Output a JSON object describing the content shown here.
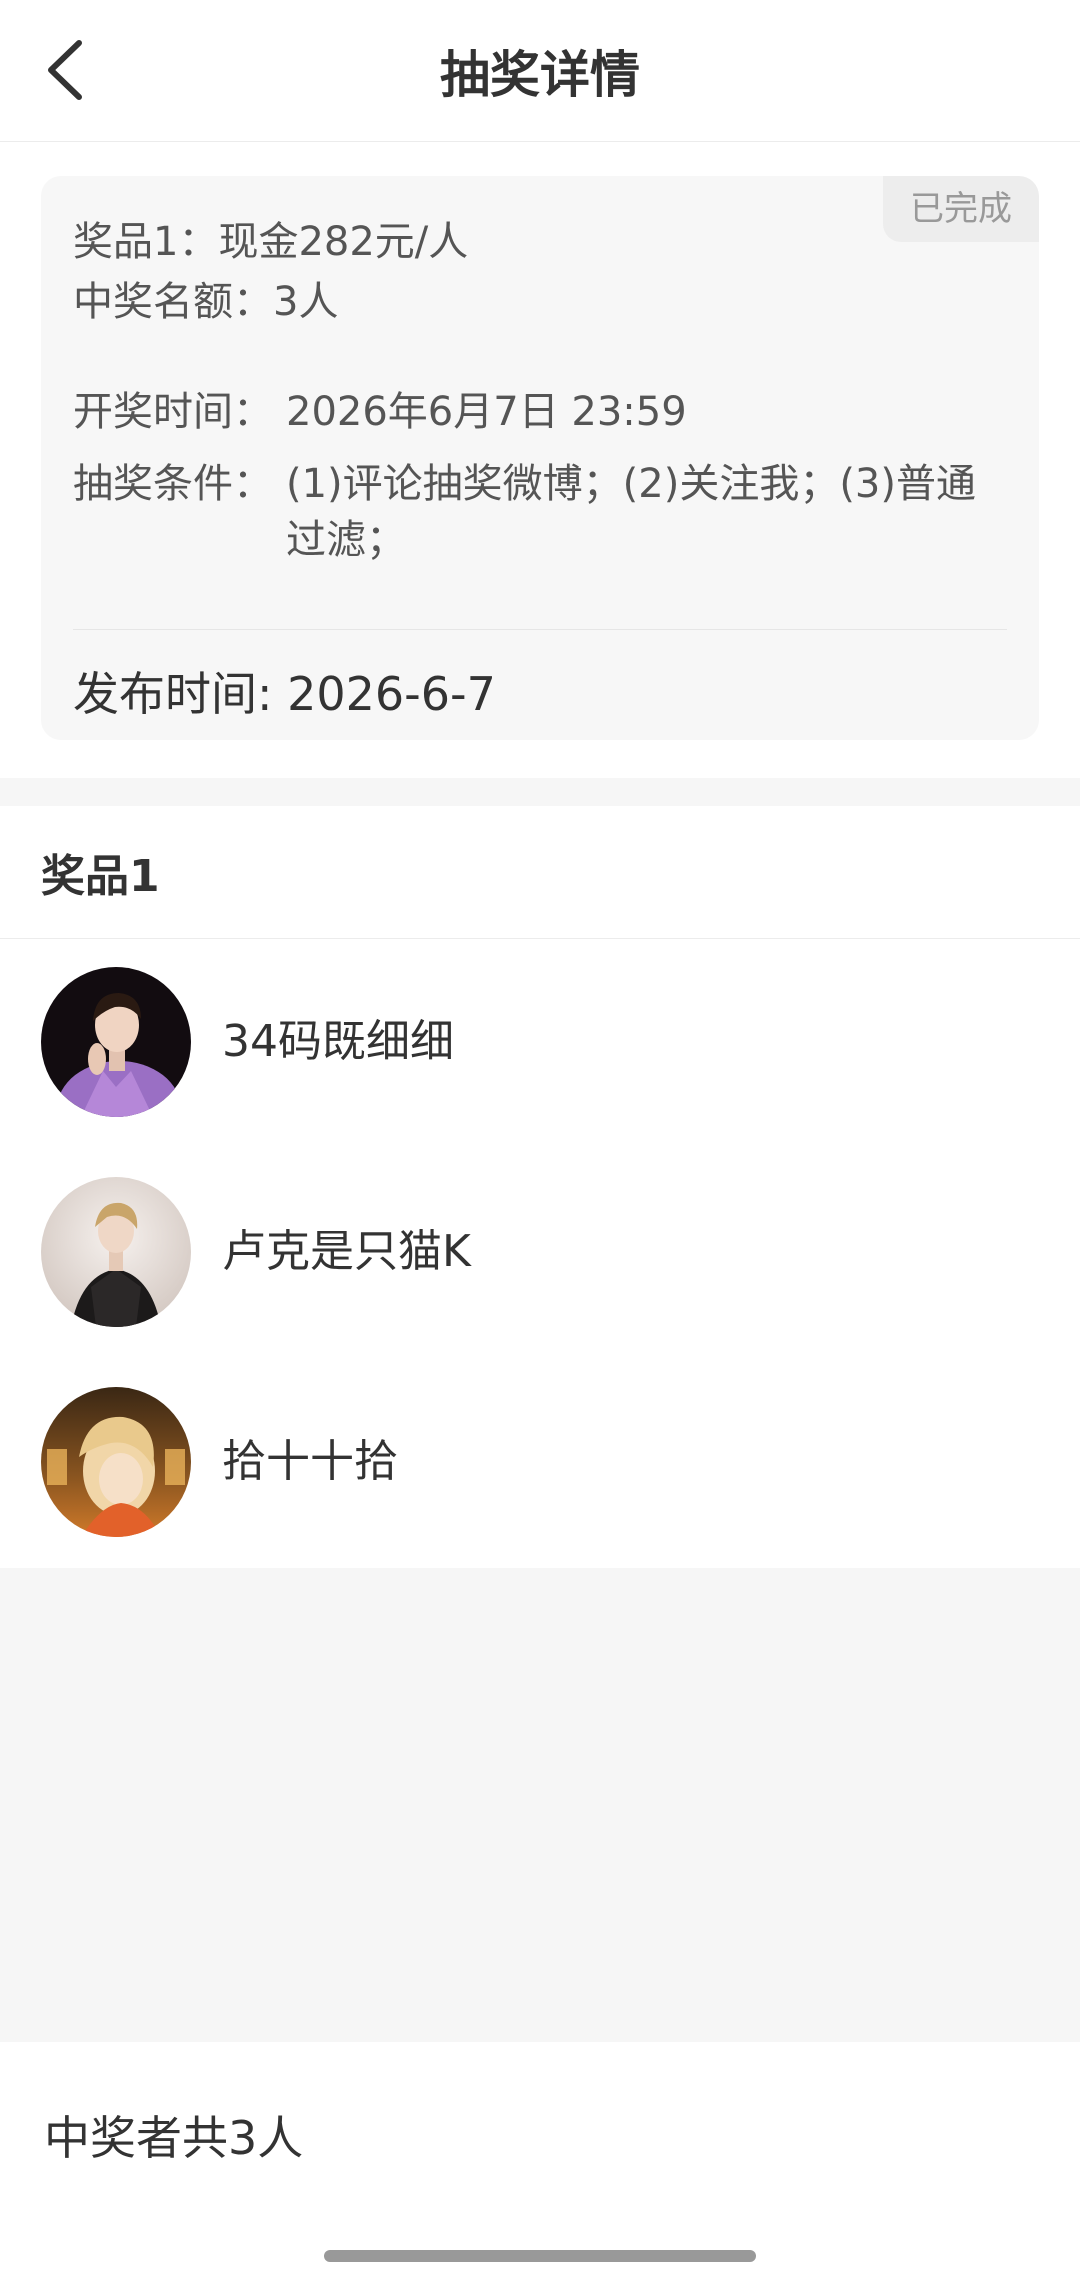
{
  "header": {
    "title": "抽奖详情",
    "back_icon": "chevron-left-icon"
  },
  "info": {
    "status": "已完成",
    "prize_line": "奖品1：现金282元/人",
    "winners_line": "中奖名额：3人",
    "draw_time_label": "开奖时间：",
    "draw_time_value": "2026年6月7日 23:59",
    "conditions_label": "抽奖条件：",
    "conditions_value": "(1)评论抽奖微博；(2)关注我；(3)普通过滤；",
    "publish_time": "发布时间: 2026-6-7"
  },
  "prize_list": {
    "title": "奖品1",
    "winners": [
      {
        "name": "34码既细细"
      },
      {
        "name": "卢克是只猫K"
      },
      {
        "name": "拾十十拾"
      }
    ]
  },
  "footer": {
    "total": "中奖者共3人"
  }
}
